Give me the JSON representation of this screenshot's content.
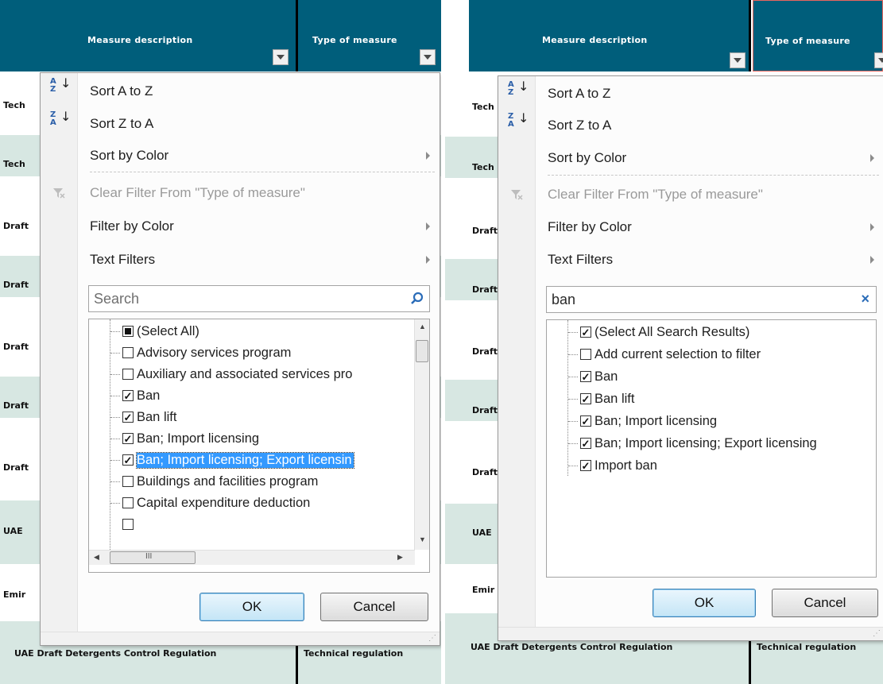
{
  "headers": {
    "measure_description": "Measure description",
    "type_of_measure": "Type of measure"
  },
  "rows_left": [
    "Tech",
    "Tech",
    "Draft",
    "Draft",
    "Draft",
    "Draft",
    "Draft",
    "UAE",
    "Emir"
  ],
  "rows_right": [
    "Tech",
    "Tech",
    "Draft",
    "Draft",
    "Draft",
    "Draft",
    "Draft",
    "UAE",
    "Emir"
  ],
  "bottom_row": {
    "description": "UAE Draft Detergents Control Regulation",
    "type": "Technical regulation"
  },
  "menu": {
    "sort_az": "Sort A to Z",
    "sort_za": "Sort Z to A",
    "sort_by_color": "Sort by Color",
    "clear_filter": "Clear Filter From \"Type of measure\"",
    "filter_by_color": "Filter by Color",
    "text_filters": "Text Filters",
    "ok": "OK",
    "cancel": "Cancel"
  },
  "left_panel": {
    "search_placeholder": "Search",
    "items": [
      {
        "label": "(Select All)",
        "state": "mixed"
      },
      {
        "label": "Advisory services program",
        "state": "unchecked"
      },
      {
        "label": "Auxiliary and associated services pro",
        "state": "unchecked"
      },
      {
        "label": "Ban",
        "state": "checked"
      },
      {
        "label": "Ban lift",
        "state": "checked"
      },
      {
        "label": "Ban; Import licensing",
        "state": "checked"
      },
      {
        "label": "Ban; Import licensing; Export licensin",
        "state": "checked",
        "selected": true
      },
      {
        "label": "Buildings and facilities program",
        "state": "unchecked"
      },
      {
        "label": "Capital expenditure deduction",
        "state": "unchecked"
      }
    ]
  },
  "right_panel": {
    "search_value": "ban",
    "items": [
      {
        "label": "(Select All Search Results)",
        "state": "checked"
      },
      {
        "label": "Add current selection to filter",
        "state": "unchecked"
      },
      {
        "label": "Ban",
        "state": "checked"
      },
      {
        "label": "Ban lift",
        "state": "checked"
      },
      {
        "label": "Ban; Import licensing",
        "state": "checked"
      },
      {
        "label": "Ban; Import licensing; Export licensing",
        "state": "checked"
      },
      {
        "label": "Import ban",
        "state": "checked"
      }
    ]
  },
  "colors": {
    "header_bg": "#005e7b",
    "row_green": "#d7e7e2",
    "selection": "#3399ff"
  }
}
